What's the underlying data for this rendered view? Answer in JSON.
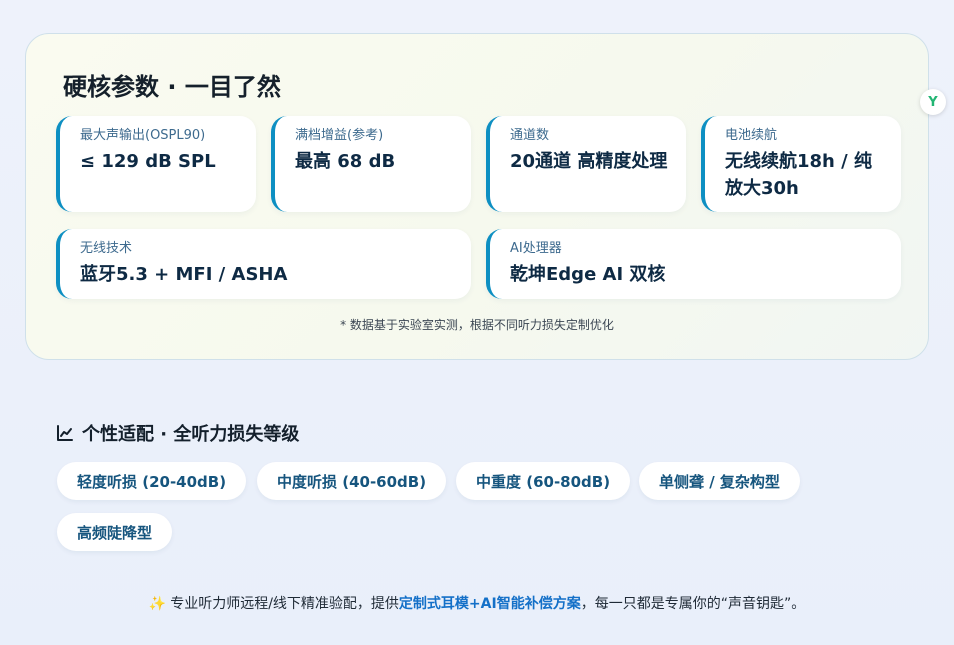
{
  "specs": {
    "title": "硬核参数 · 一目了然",
    "cards": [
      {
        "label": "最大声输出(OSPL90)",
        "value": "≤ 129 dB SPL"
      },
      {
        "label": "满档增益(参考)",
        "value": "最高 68 dB"
      },
      {
        "label": "通道数",
        "value": "20通道 高精度处理"
      },
      {
        "label": "电池续航",
        "value": "无线续航18h / 纯放大30h"
      },
      {
        "label": "无线技术",
        "value": "蓝牙5.3 + MFI / ASHA"
      },
      {
        "label": "AI处理器",
        "value": "乾坤Edge AI 双核"
      }
    ],
    "footnote": "* 数据基于实验室实测，根据不同听力损失定制优化"
  },
  "badge": {
    "letter": "Y"
  },
  "fitting": {
    "title": "个性适配 · 全听力损失等级",
    "icon": "chart-line-icon",
    "levels": [
      "轻度听损 (20-40dB)",
      "中度听损 (40-60dB)",
      "中重度 (60-80dB)",
      "单侧聋 / 复杂构型",
      "高频陡降型"
    ]
  },
  "note": {
    "icon": "sparkle-icon",
    "prefix": "专业听力师远程/线下精准验配，提供",
    "highlight": "定制式耳模+AI智能补偿方案",
    "suffix": "，每一只都是专属你的“声音钥匙”。"
  },
  "colors": {
    "accent": "#0d8fc2",
    "chip_text": "#16557e",
    "highlight": "#1470c8"
  }
}
